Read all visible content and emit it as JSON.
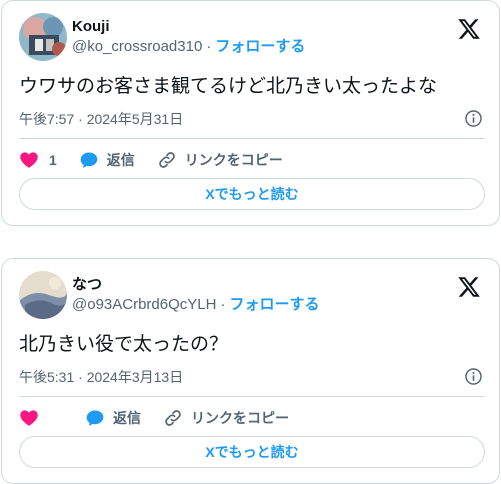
{
  "tweets": [
    {
      "display_name": "Kouji",
      "handle": "@ko_crossroad310",
      "follow_label": "フォローする",
      "text": "ウワサのお客さま観てるけど北乃きい太ったよな",
      "timestamp": "午後7:57 · 2024年5月31日",
      "like_count": "1",
      "reply_label": "返信",
      "copy_link_label": "リンクをコピー",
      "read_more_label": "Xでもっと読む"
    },
    {
      "display_name": "なつ",
      "handle": "@o93ACrbrd6QcYLH",
      "follow_label": "フォローする",
      "text": "北乃きい役で太ったの？",
      "timestamp": "午後5:31 · 2024年3月13日",
      "like_count": "",
      "reply_label": "返信",
      "copy_link_label": "リンクをコピー",
      "read_more_label": "Xでもっと読む"
    }
  ],
  "colors": {
    "accent": "#1d9bf0",
    "like": "#f91880",
    "text": "#0f1419",
    "muted": "#536471",
    "border": "#cfd9de"
  },
  "icons": [
    "x-logo-icon",
    "info-icon",
    "heart-icon",
    "reply-bubble-icon",
    "link-icon"
  ]
}
